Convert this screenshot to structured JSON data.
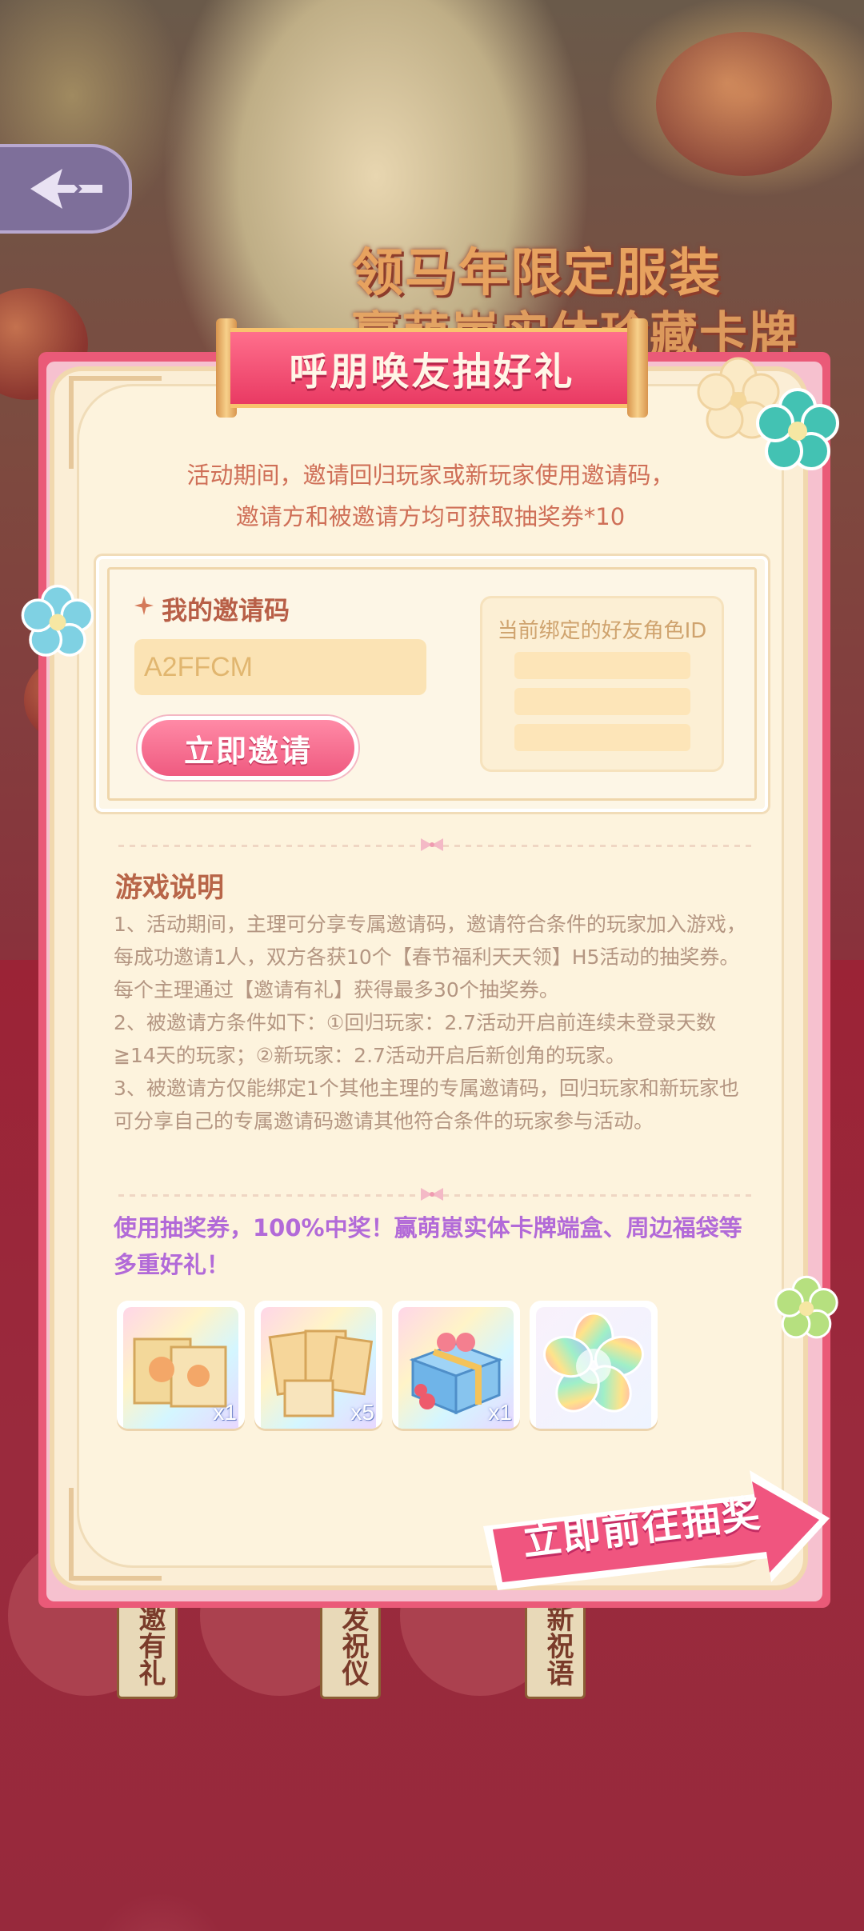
{
  "background": {
    "banner_line1": "领马年限定服装",
    "banner_line2": "赢萌崽实体珍藏卡牌",
    "tags": [
      "邀有礼",
      "发祝仪",
      "新祝语"
    ]
  },
  "modal": {
    "title": "呼朋唤友抽好礼",
    "intro_line1": "活动期间，邀请回归玩家或新玩家使用邀请码，",
    "intro_line2": "邀请方和被邀请方均可获取抽奖券*10",
    "invite": {
      "label": "我的邀请码",
      "code": "A2FFCM",
      "button": "立即邀请",
      "bound_label": "当前绑定的好友角色ID"
    },
    "rules_title": "游戏说明",
    "rules": [
      "1、活动期间，主理可分享专属邀请码，邀请符合条件的玩家加入游戏，每成功邀请1人，双方各获10个【春节福利天天领】H5活动的抽奖券。每个主理通过【邀请有礼】获得最多30个抽奖券。",
      "2、被邀请方条件如下：①回归玩家：2.7活动开启前连续未登录天数≧14天的玩家；②新玩家：2.7活动开启后新创角的玩家。",
      "3、被邀请方仅能绑定1个其他主理的专属邀请码，回归玩家和新玩家也可分享自己的专属邀请码邀请其他符合条件的玩家参与活动。"
    ],
    "highlight": "使用抽奖券，100%中奖！赢萌崽实体卡牌端盒、周边福袋等多重好礼！",
    "rewards": [
      {
        "name": "card-box",
        "qty": "x1"
      },
      {
        "name": "card-packs",
        "qty": "x5"
      },
      {
        "name": "gift-box",
        "qty": "x1"
      },
      {
        "name": "rainbow-flower",
        "qty": ""
      }
    ],
    "go_button": "立即前往抽奖"
  },
  "colors": {
    "primary_pink": "#ef5a80",
    "modal_bg": "#fdf3dd",
    "highlight_purple": "#b26ad8",
    "rule_text": "#b49682"
  }
}
